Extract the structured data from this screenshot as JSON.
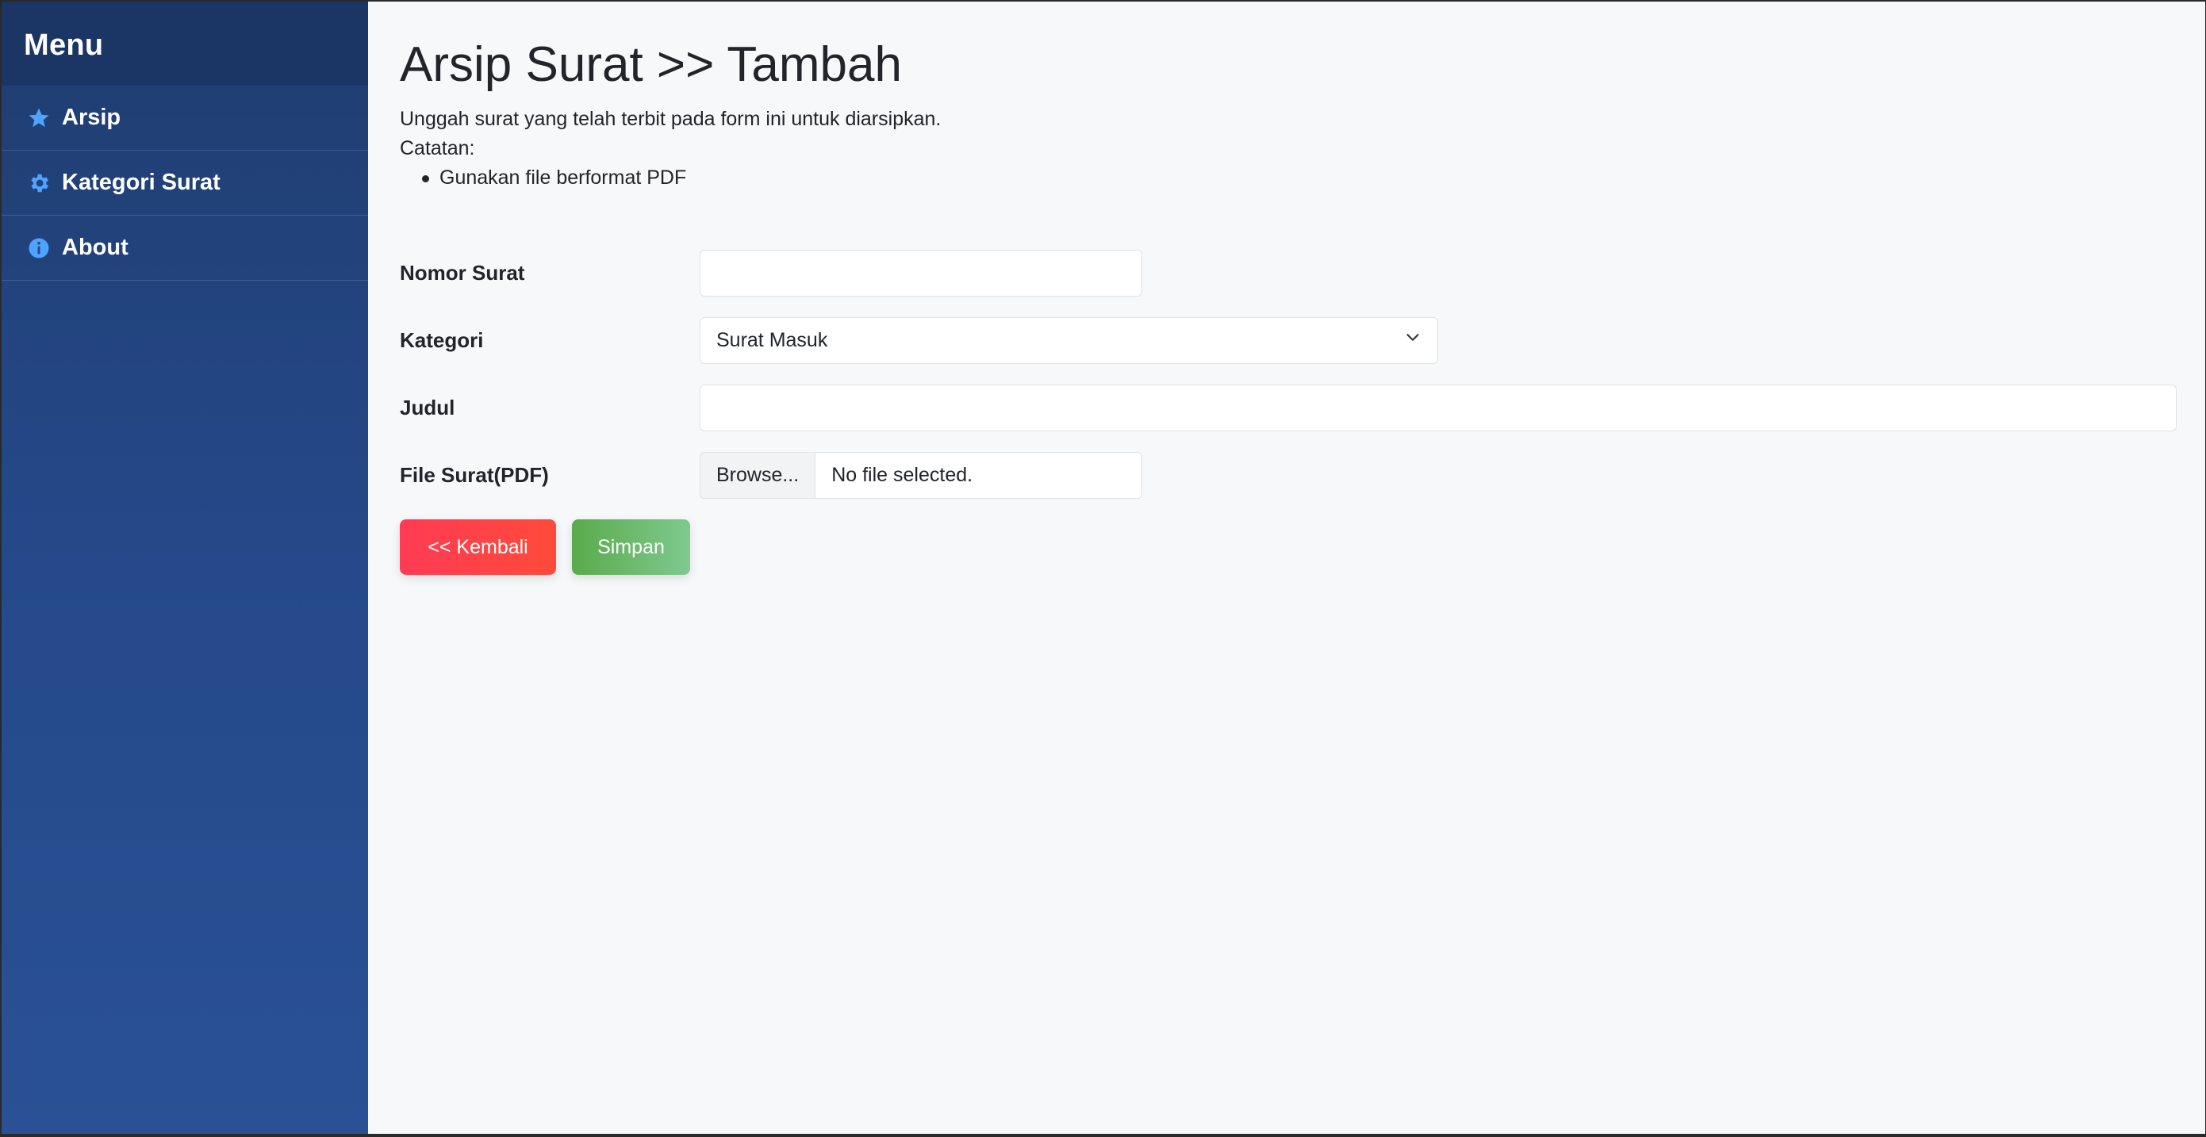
{
  "sidebar": {
    "title": "Menu",
    "items": [
      {
        "label": "Arsip",
        "icon": "star-icon"
      },
      {
        "label": "Kategori Surat",
        "icon": "gear-icon"
      },
      {
        "label": "About",
        "icon": "info-icon"
      }
    ]
  },
  "main": {
    "title": "Arsip Surat >> Tambah",
    "description": "Unggah surat yang telah terbit pada form ini untuk diarsipkan.",
    "note_label": "Catatan:",
    "notes": [
      "Gunakan file berformat PDF"
    ]
  },
  "form": {
    "nomor_label": "Nomor Surat",
    "nomor_value": "",
    "kategori_label": "Kategori",
    "kategori_value": "Surat Masuk",
    "judul_label": "Judul",
    "judul_value": "",
    "file_label": "File Surat(PDF)",
    "file_browse": "Browse...",
    "file_status": "No file selected."
  },
  "buttons": {
    "back": "<< Kembali",
    "save": "Simpan"
  },
  "colors": {
    "icon_accent": "#4da3ff",
    "back_button": "#ff3b55",
    "save_button": "#5aab4b",
    "sidebar": "#25498a"
  }
}
